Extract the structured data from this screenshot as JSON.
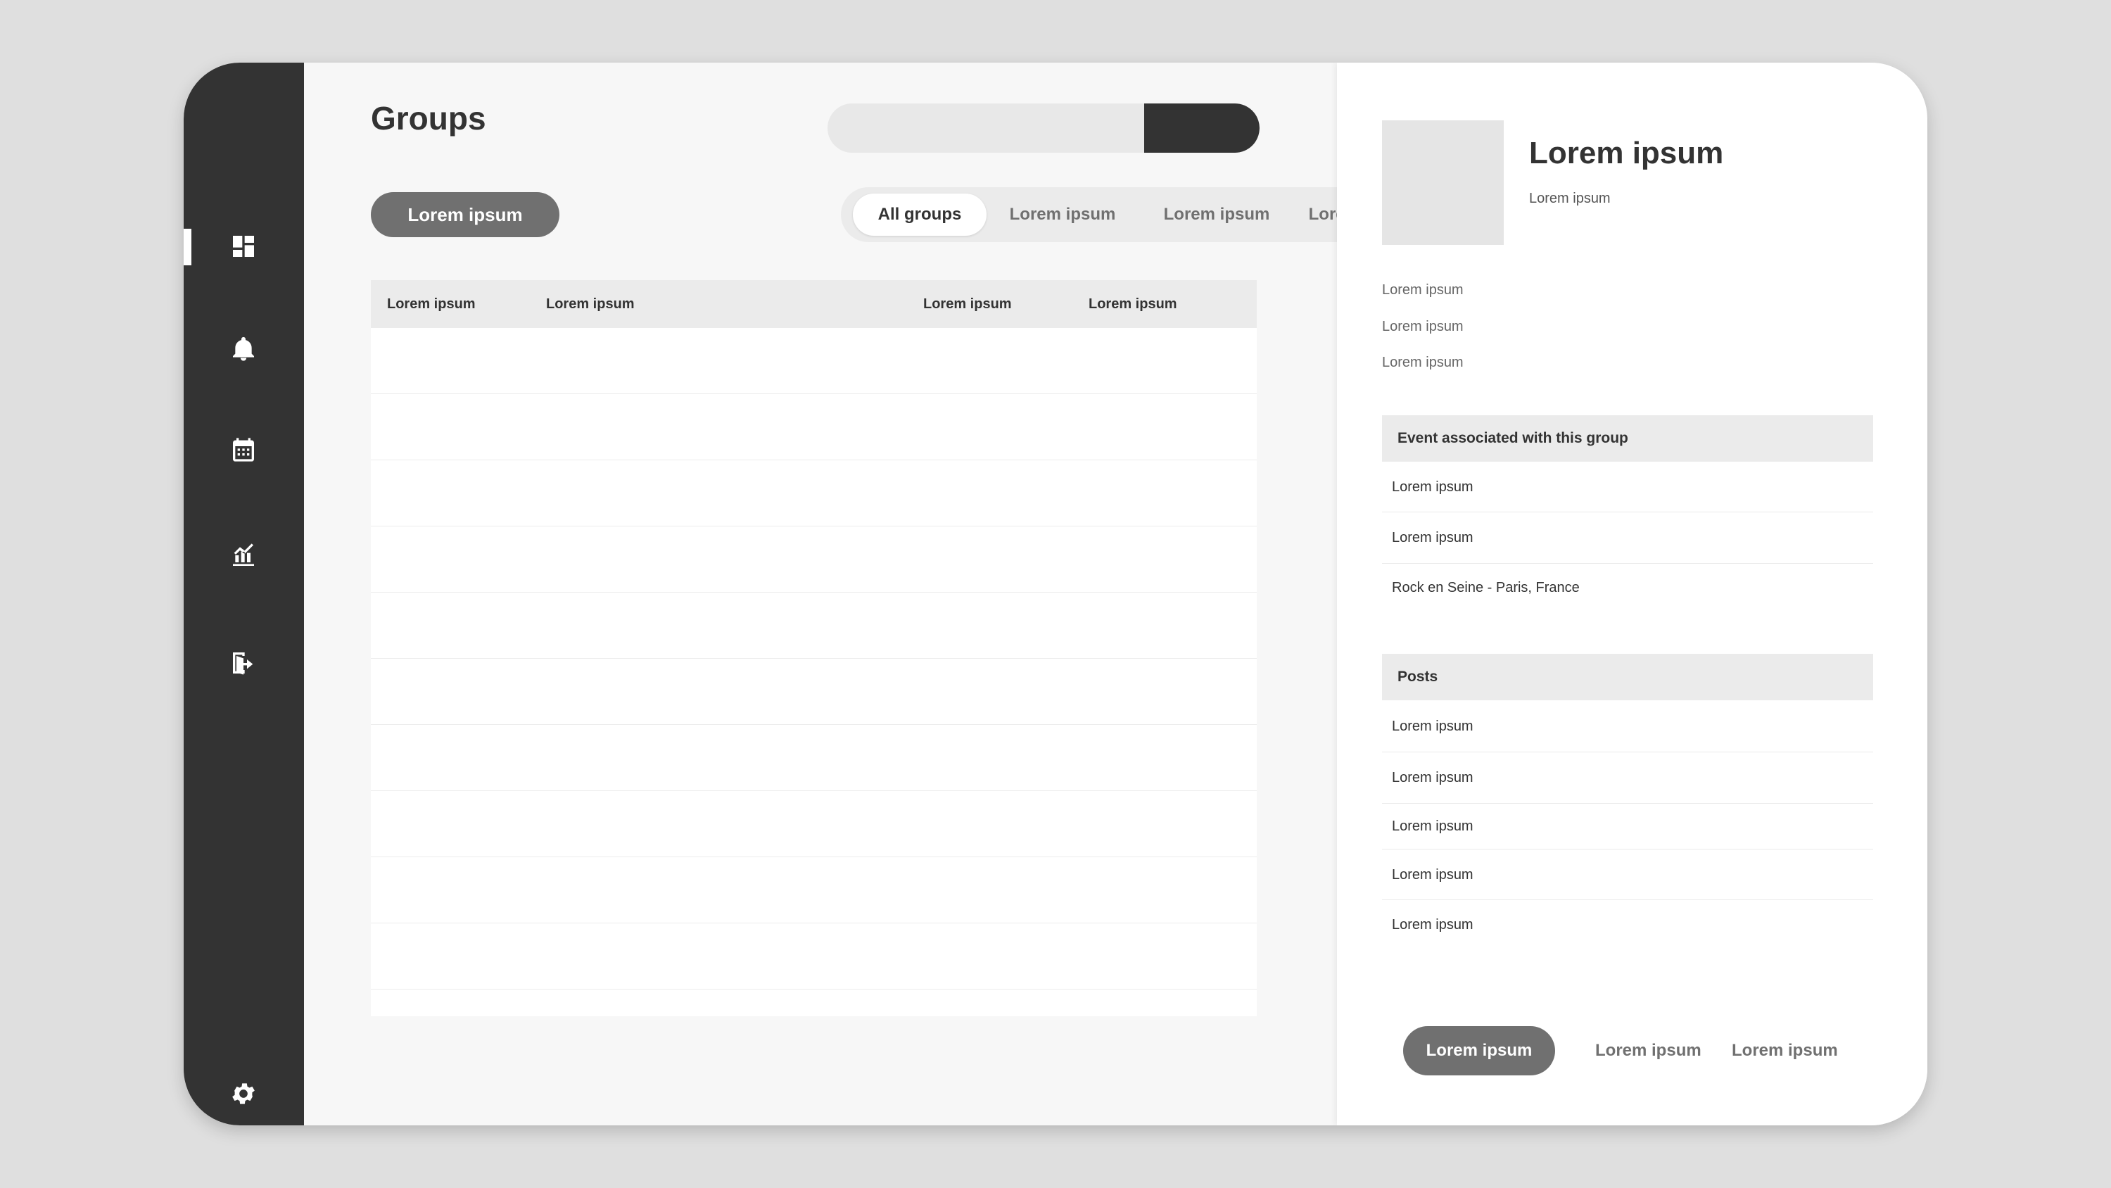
{
  "sidebar": {
    "items": [
      {
        "icon": "dashboard-icon",
        "active": true
      },
      {
        "icon": "bell-icon",
        "active": false
      },
      {
        "icon": "calendar-icon",
        "active": false
      },
      {
        "icon": "analytics-icon",
        "active": false
      },
      {
        "icon": "logout-icon",
        "active": false
      }
    ],
    "settings_icon": "gear-icon"
  },
  "main": {
    "title": "Groups",
    "search": {
      "placeholder": "",
      "value": ""
    },
    "primary_button": "Lorem ipsum",
    "filter_tabs": [
      {
        "label": "All groups",
        "active": true
      },
      {
        "label": "Lorem ipsum",
        "active": false
      },
      {
        "label": "Lorem ipsum",
        "active": false
      },
      {
        "label": "Lorem ipsum",
        "active": false
      }
    ],
    "table": {
      "columns": [
        "Lorem ipsum",
        "Lorem ipsum",
        "Lorem ipsum",
        "Lorem ipsum"
      ],
      "rows": [
        [],
        [],
        [],
        [],
        [],
        [],
        [],
        [],
        [],
        [],
        []
      ]
    }
  },
  "panel": {
    "name": "Lorem ipsum",
    "subtitle": "Lorem ipsum",
    "info": [
      "Lorem ipsum",
      "Lorem ipsum",
      "Lorem ipsum"
    ],
    "events": {
      "title": "Event associated with this group",
      "items": [
        "Lorem ipsum",
        "Lorem ipsum",
        "Rock en Seine - Paris, France"
      ]
    },
    "posts": {
      "title": "Posts",
      "items": [
        "Lorem ipsum",
        "Lorem ipsum",
        "Lorem ipsum",
        "Lorem ipsum",
        "Lorem ipsum"
      ]
    },
    "actions": {
      "primary": "Lorem ipsum",
      "secondary": [
        "Lorem ipsum",
        "Lorem ipsum"
      ]
    }
  },
  "colors": {
    "sidebar": "#333333",
    "accent_pill": "#707070",
    "background": "#dfdfdf",
    "header_gray": "#ebebeb"
  }
}
